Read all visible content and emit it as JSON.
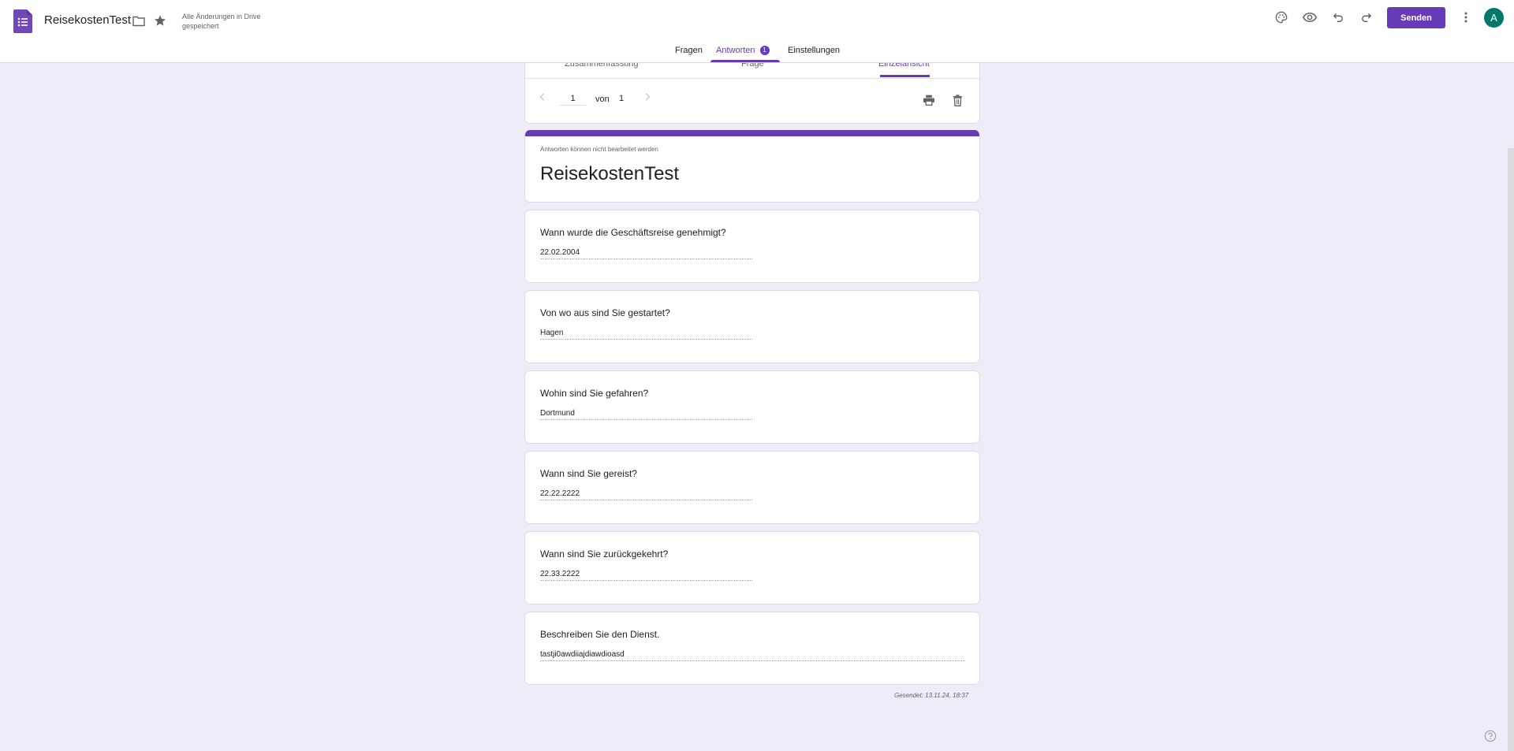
{
  "header": {
    "title": "ReisekostenTest",
    "save_status": "Alle Änderungen in Drive gespeichert",
    "send_label": "Senden",
    "avatar_letter": "A",
    "icons": [
      "forms-app-icon",
      "folder-icon",
      "star-icon",
      "palette-icon",
      "preview-icon",
      "undo-icon",
      "redo-icon",
      "more-vert-icon"
    ]
  },
  "tabs": {
    "questions": "Fragen",
    "responses": "Antworten",
    "responses_count": "1",
    "settings": "Einstellungen"
  },
  "subtabs": {
    "summary": "Zusammenfassung",
    "question": "Frage",
    "individual": "Einzelansicht"
  },
  "pager": {
    "current": "1",
    "of": "von",
    "total": "1"
  },
  "form": {
    "readonly_note": "Antworten können nicht bearbeitet werden",
    "title": "ReisekostenTest"
  },
  "questions": [
    {
      "text": "Wann wurde die Geschäftsreise genehmigt?",
      "answer": "22.02.2004"
    },
    {
      "text": "Von wo aus sind Sie gestartet?",
      "answer": "Hagen"
    },
    {
      "text": "Wohin sind Sie gefahren?",
      "answer": "Dortmund"
    },
    {
      "text": "Wann sind Sie gereist?",
      "answer": "22.22.2222"
    },
    {
      "text": "Wann sind Sie zurückgekehrt?",
      "answer": "22.33.2222"
    },
    {
      "text": "Beschreiben Sie den Dienst.",
      "answer": "tastji0awdiiajdiawdioasd"
    }
  ],
  "submitted": "Gesendet: 13.11.24, 18:37",
  "colors": {
    "accent": "#673ab7",
    "background": "#f0ebf8",
    "avatar": "#00796b"
  }
}
